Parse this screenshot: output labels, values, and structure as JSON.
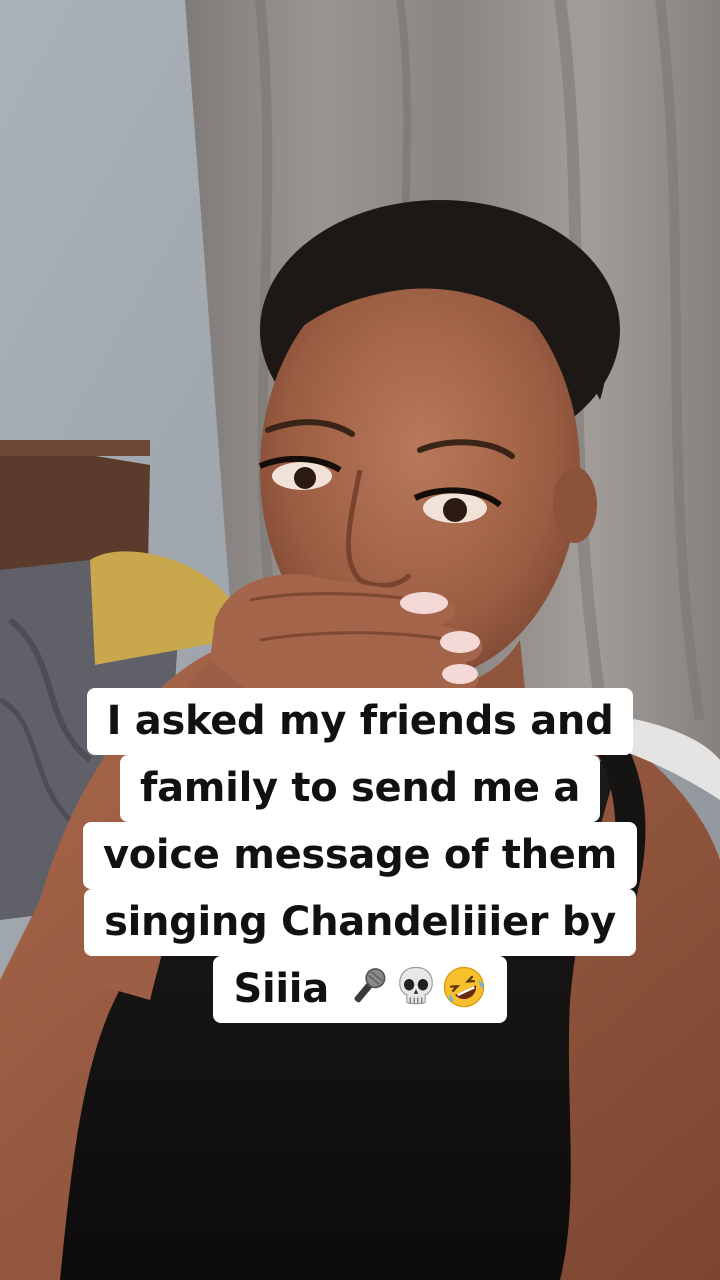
{
  "video": {
    "scene": "woman-covering-mouth-bedroom"
  },
  "caption": {
    "lines": [
      "I asked my friends and",
      "family to send me a",
      "voice message of them",
      "singing Chandeliiier by",
      "Siiia"
    ],
    "emojis": [
      "microphone-emoji",
      "skull-emoji",
      "rolling-laughing-emoji"
    ]
  },
  "colors": {
    "caption_background": "#ffffff",
    "caption_text": "#111111"
  }
}
